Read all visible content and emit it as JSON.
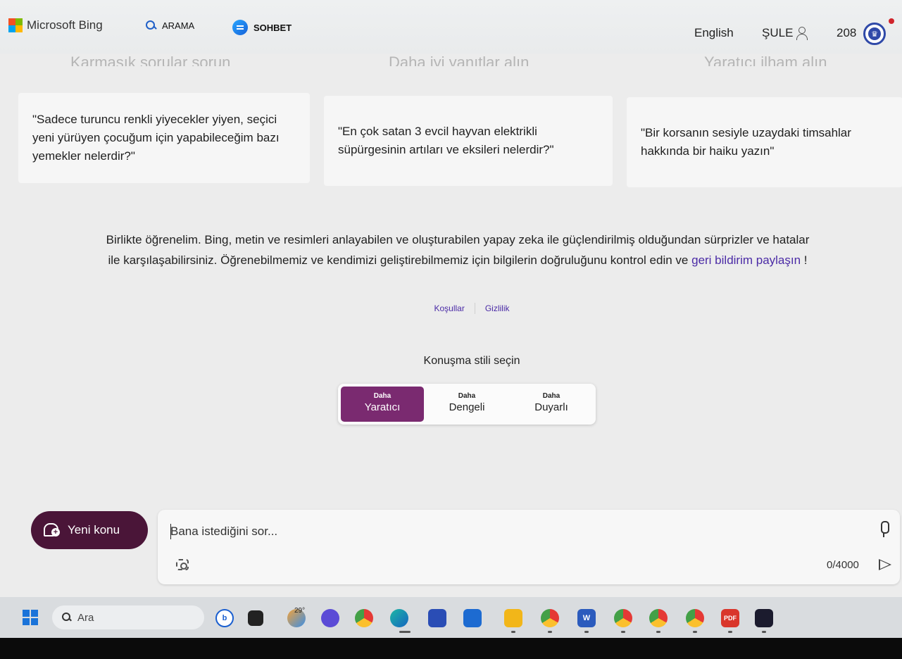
{
  "header": {
    "brand": "Microsoft Bing",
    "nav": [
      {
        "label": "ARAMA",
        "icon": "search-icon"
      },
      {
        "label": "SOHBET",
        "icon": "chat-icon"
      }
    ],
    "language": "English",
    "user": "ŞULE",
    "points": "208",
    "faded_headings": [
      "Karmaşık sorular sorun",
      "Daha iyi yanıtlar alın",
      "Yaratıcı ilham alın"
    ]
  },
  "suggestions": [
    "\"Sadece turuncu renkli yiyecekler yiyen, seçici yeni yürüyen çocuğum için yapabileceğim bazı yemekler nelerdir?\"",
    "\"En çok satan 3 evcil hayvan elektrikli süpürgesinin artıları ve eksileri nelerdir?\"",
    "\"Bir korsanın sesiyle uzaydaki timsahlar hakkında bir haiku yazın\""
  ],
  "info": {
    "text": "Birlikte öğrenelim. Bing, metin ve resimleri anlayabilen ve oluşturabilen yapay zeka ile güçlendirilmiş olduğundan sürprizler ve hatalar ile karşılaşabilirsiniz. Öğrenebilmemiz ve kendimizi geliştirebilmemiz için bilgilerin doğruluğunu kontrol edin ve",
    "link": "geri bildirim paylaşın",
    "suffix": " !"
  },
  "links": {
    "terms": "Koşullar",
    "privacy": "Gizlilik"
  },
  "style_picker": {
    "title": "Konuşma stili seçin",
    "options": [
      {
        "small": "Daha",
        "big": "Yaratıcı",
        "selected": true
      },
      {
        "small": "Daha",
        "big": "Dengeli",
        "selected": false
      },
      {
        "small": "Daha",
        "big": "Duyarlı",
        "selected": false
      }
    ]
  },
  "composer": {
    "new_topic": "Yeni konu",
    "placeholder": "Bana istediğini sor...",
    "counter": "0/4000"
  },
  "taskbar": {
    "search_label": "Ara",
    "weather_temp": "29°",
    "apps": [
      "bing-icon",
      "terminal-icon",
      "weather-icon",
      "teams-icon",
      "chrome-icon",
      "edge-icon",
      "store-icon",
      "mail-icon",
      "file-explorer-icon",
      "chrome-profile-icon",
      "word-icon",
      "chrome-profile-icon",
      "chrome-profile-icon",
      "chrome-profile-icon",
      "pdf-icon",
      "audio-app-icon"
    ]
  },
  "colors": {
    "accent": "#7a2a70",
    "new_topic_bg": "#4a1538",
    "link": "#4b2ba6"
  }
}
